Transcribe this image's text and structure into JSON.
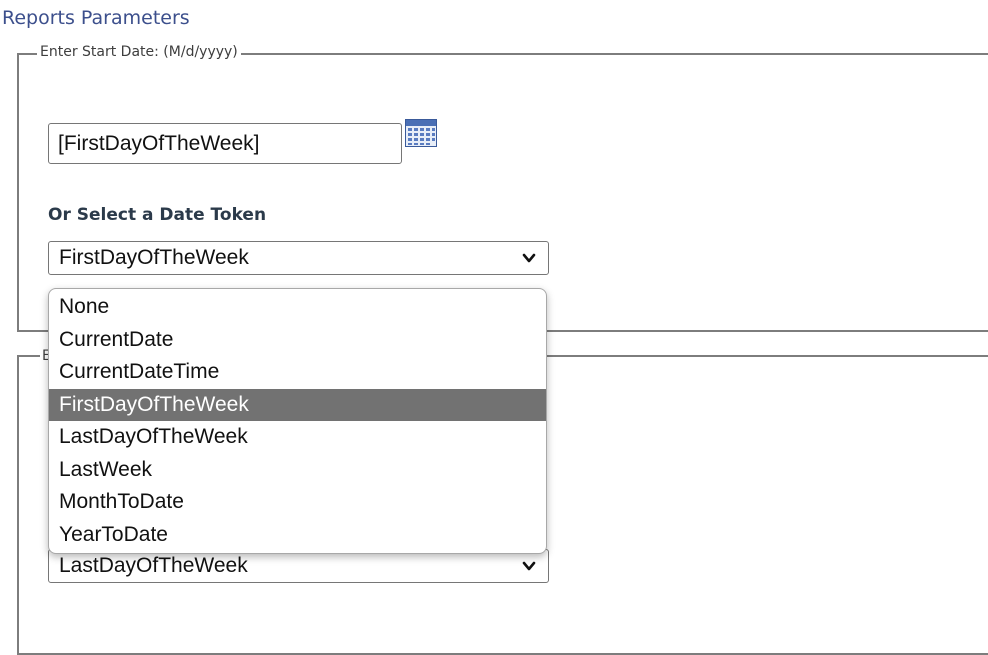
{
  "page": {
    "title": "Reports Parameters"
  },
  "start_date": {
    "legend": "Enter Start Date: (M/d/yyyy)",
    "input_value": "[FirstDayOfTheWeek]",
    "calendar_icon": "calendar-icon",
    "token_label": "Or Select a Date Token",
    "selected_token": "FirstDayOfTheWeek"
  },
  "end_date": {
    "legend_visible": "E",
    "selected_token": "LastDayOfTheWeek"
  },
  "token_dropdown": {
    "options": [
      "None",
      "CurrentDate",
      "CurrentDateTime",
      "FirstDayOfTheWeek",
      "LastDayOfTheWeek",
      "LastWeek",
      "MonthToDate",
      "YearToDate"
    ],
    "highlighted": "FirstDayOfTheWeek"
  },
  "colors": {
    "title": "#3c4f8c",
    "highlight_bg": "#727272",
    "highlight_text": "#ffffff",
    "border": "#7d7d7d"
  }
}
